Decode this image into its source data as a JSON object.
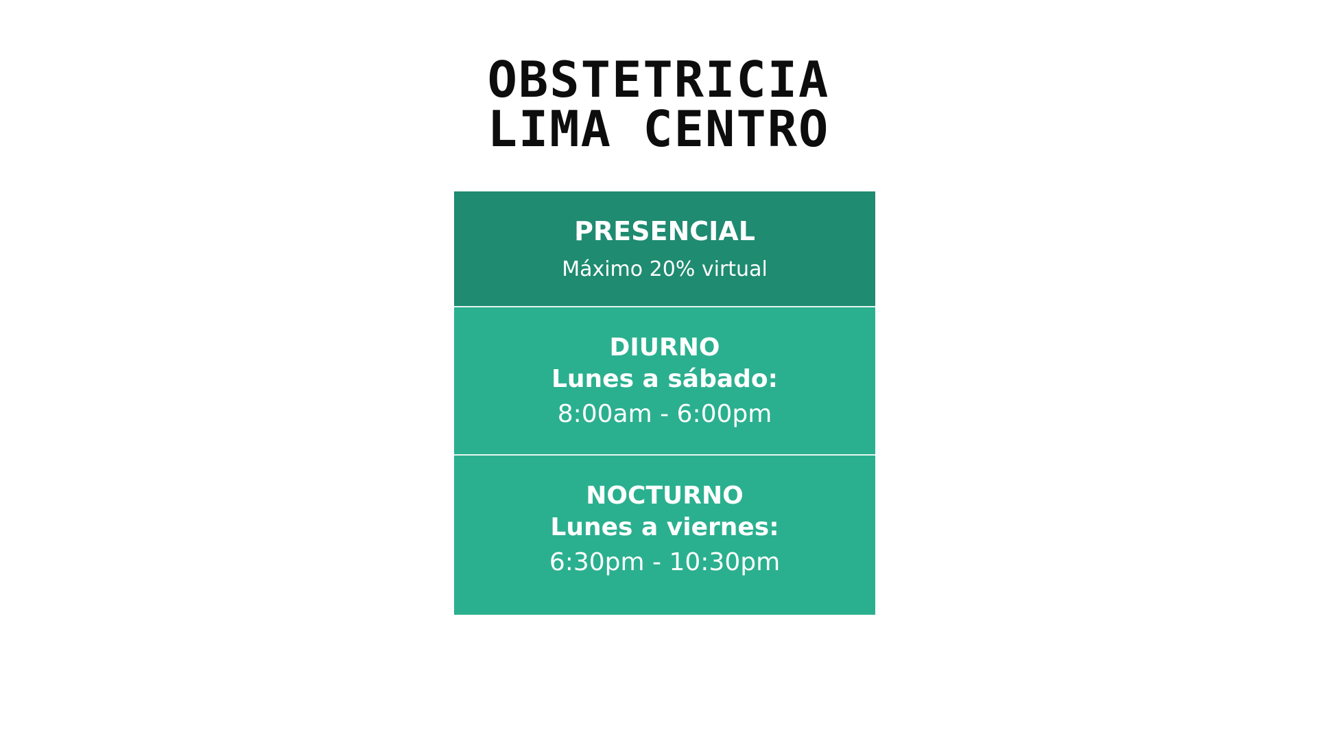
{
  "heading": {
    "line1": "OBSTETRICIA",
    "line2": "LIMA CENTRO"
  },
  "modality": {
    "title": "PRESENCIAL",
    "note": "Máximo 20% virtual"
  },
  "schedules": [
    {
      "shift": "DIURNO",
      "days": "Lunes a sábado:",
      "hours": "8:00am - 6:00pm"
    },
    {
      "shift": "NOCTURNO",
      "days": "Lunes a viernes:",
      "hours": "6:30pm - 10:30pm"
    }
  ],
  "colors": {
    "header_bg": "#1f8b70",
    "row_bg": "#2bb08f",
    "text": "#ffffff",
    "title_text": "#0d0d0d"
  }
}
